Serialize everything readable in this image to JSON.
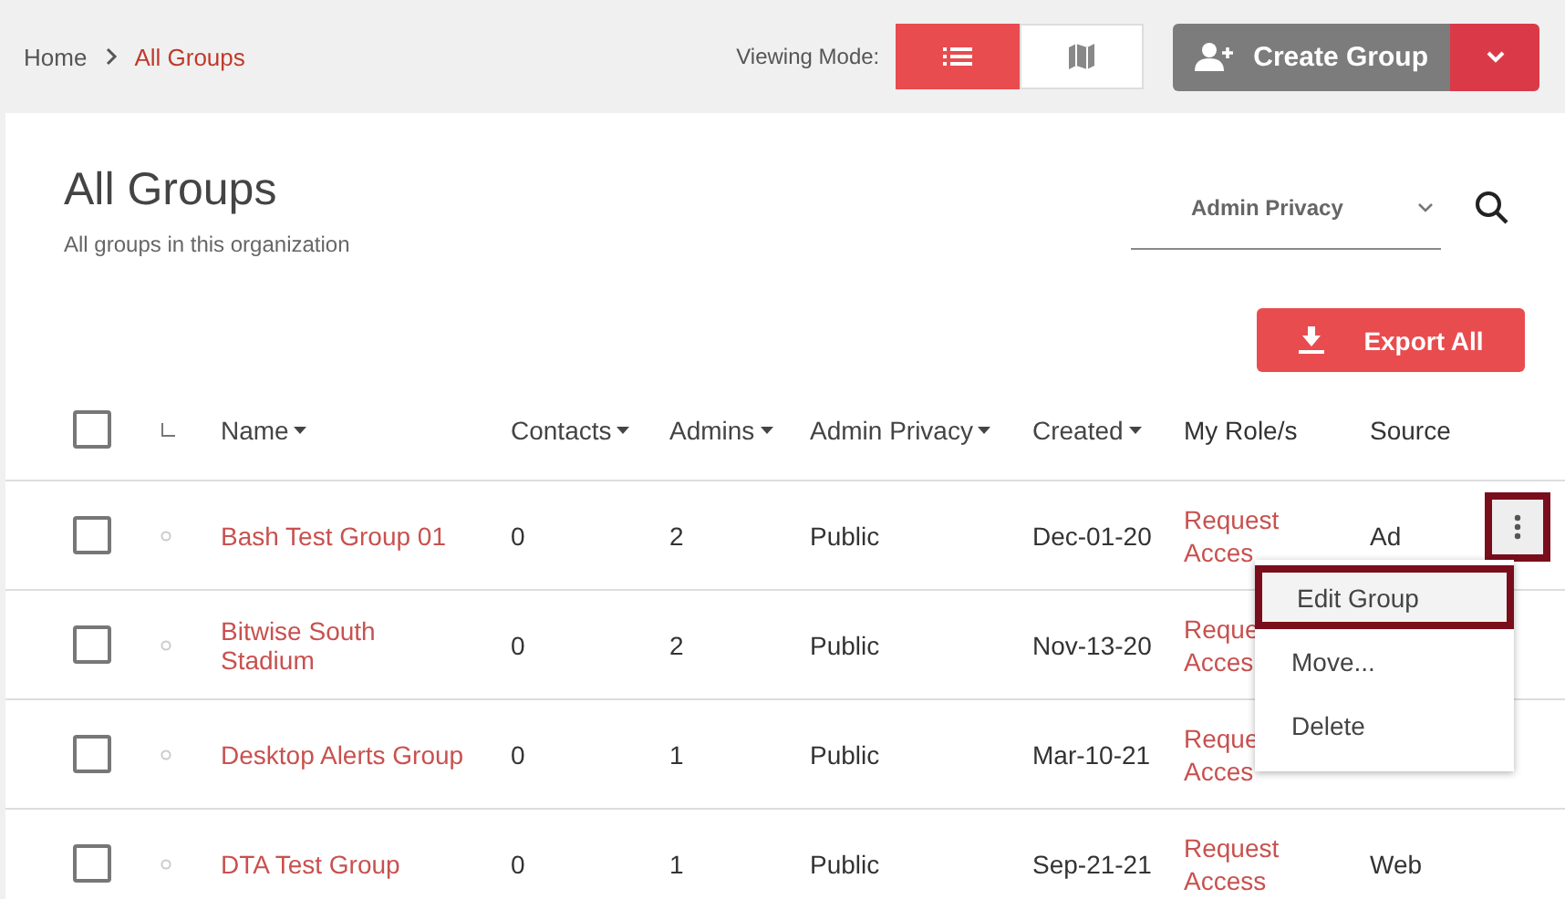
{
  "breadcrumb": [
    {
      "label": "Home",
      "current": false
    },
    {
      "label": "All Groups",
      "current": true
    }
  ],
  "viewing_mode": {
    "label": "Viewing Mode:",
    "options": [
      {
        "kind": "list",
        "selected": true
      },
      {
        "kind": "map",
        "selected": false
      }
    ]
  },
  "create_button": {
    "label": "Create Group"
  },
  "page": {
    "title": "All Groups",
    "subtitle": "All groups in this organization"
  },
  "filter": {
    "value": "Admin Privacy"
  },
  "export_button": {
    "label": "Export All"
  },
  "table": {
    "select_all_checked": false,
    "columns": [
      {
        "label": "Name",
        "sortable": true
      },
      {
        "label": "Contacts",
        "sortable": true
      },
      {
        "label": "Admins",
        "sortable": true
      },
      {
        "label": "Admin Privacy",
        "sortable": true
      },
      {
        "label": "Created",
        "sortable": true
      },
      {
        "label": "My Role/s",
        "sortable": false
      },
      {
        "label": "Source",
        "sortable": false
      }
    ],
    "rows": [
      {
        "checked": false,
        "name": "Bash Test Group 01",
        "contacts": "0",
        "admins": "2",
        "admin_privacy": "Public",
        "created": "Dec-01-20",
        "role": [
          "Request",
          "Acces"
        ],
        "source": [
          "Ad"
        ],
        "menu_open": true
      },
      {
        "checked": false,
        "name": "Bitwise South Stadium",
        "contacts": "0",
        "admins": "2",
        "admin_privacy": "Public",
        "created": "Nov-13-20",
        "role": [
          "Reque",
          "Acces"
        ],
        "source": [],
        "menu_open": false
      },
      {
        "checked": false,
        "name": "Desktop Alerts Group",
        "contacts": "0",
        "admins": "1",
        "admin_privacy": "Public",
        "created": "Mar-10-21",
        "role": [
          "Reque",
          "Acces"
        ],
        "source": [],
        "menu_open": false
      },
      {
        "checked": false,
        "name": "DTA Test Group",
        "contacts": "0",
        "admins": "1",
        "admin_privacy": "Public",
        "created": "Sep-21-21",
        "role": [
          "Request",
          "Access"
        ],
        "source": [
          "Web"
        ],
        "menu_open": false
      }
    ]
  },
  "row_menu": {
    "items": [
      {
        "label": "Edit Group",
        "selected": true
      },
      {
        "label": "Move...",
        "selected": false
      },
      {
        "label": "Delete",
        "selected": false
      }
    ]
  }
}
